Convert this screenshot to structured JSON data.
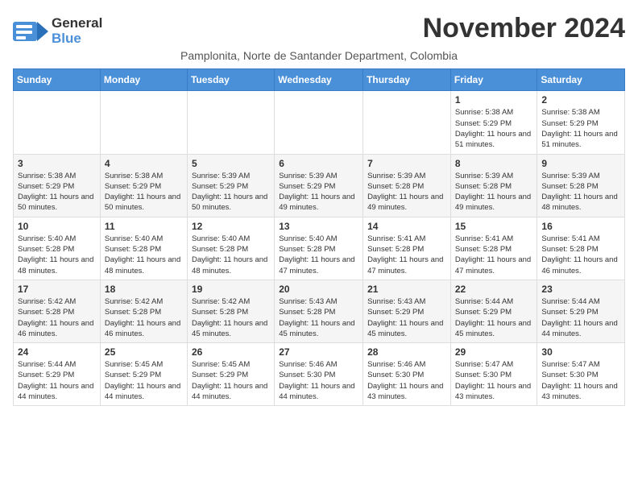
{
  "header": {
    "logo_general": "General",
    "logo_blue": "Blue",
    "month_title": "November 2024",
    "location": "Pamplonita, Norte de Santander Department, Colombia"
  },
  "weekdays": [
    "Sunday",
    "Monday",
    "Tuesday",
    "Wednesday",
    "Thursday",
    "Friday",
    "Saturday"
  ],
  "weeks": [
    [
      {
        "day": "",
        "info": ""
      },
      {
        "day": "",
        "info": ""
      },
      {
        "day": "",
        "info": ""
      },
      {
        "day": "",
        "info": ""
      },
      {
        "day": "",
        "info": ""
      },
      {
        "day": "1",
        "info": "Sunrise: 5:38 AM\nSunset: 5:29 PM\nDaylight: 11 hours\nand 51 minutes."
      },
      {
        "day": "2",
        "info": "Sunrise: 5:38 AM\nSunset: 5:29 PM\nDaylight: 11 hours\nand 51 minutes."
      }
    ],
    [
      {
        "day": "3",
        "info": "Sunrise: 5:38 AM\nSunset: 5:29 PM\nDaylight: 11 hours\nand 50 minutes."
      },
      {
        "day": "4",
        "info": "Sunrise: 5:38 AM\nSunset: 5:29 PM\nDaylight: 11 hours\nand 50 minutes."
      },
      {
        "day": "5",
        "info": "Sunrise: 5:39 AM\nSunset: 5:29 PM\nDaylight: 11 hours\nand 50 minutes."
      },
      {
        "day": "6",
        "info": "Sunrise: 5:39 AM\nSunset: 5:29 PM\nDaylight: 11 hours\nand 49 minutes."
      },
      {
        "day": "7",
        "info": "Sunrise: 5:39 AM\nSunset: 5:28 PM\nDaylight: 11 hours\nand 49 minutes."
      },
      {
        "day": "8",
        "info": "Sunrise: 5:39 AM\nSunset: 5:28 PM\nDaylight: 11 hours\nand 49 minutes."
      },
      {
        "day": "9",
        "info": "Sunrise: 5:39 AM\nSunset: 5:28 PM\nDaylight: 11 hours\nand 48 minutes."
      }
    ],
    [
      {
        "day": "10",
        "info": "Sunrise: 5:40 AM\nSunset: 5:28 PM\nDaylight: 11 hours\nand 48 minutes."
      },
      {
        "day": "11",
        "info": "Sunrise: 5:40 AM\nSunset: 5:28 PM\nDaylight: 11 hours\nand 48 minutes."
      },
      {
        "day": "12",
        "info": "Sunrise: 5:40 AM\nSunset: 5:28 PM\nDaylight: 11 hours\nand 48 minutes."
      },
      {
        "day": "13",
        "info": "Sunrise: 5:40 AM\nSunset: 5:28 PM\nDaylight: 11 hours\nand 47 minutes."
      },
      {
        "day": "14",
        "info": "Sunrise: 5:41 AM\nSunset: 5:28 PM\nDaylight: 11 hours\nand 47 minutes."
      },
      {
        "day": "15",
        "info": "Sunrise: 5:41 AM\nSunset: 5:28 PM\nDaylight: 11 hours\nand 47 minutes."
      },
      {
        "day": "16",
        "info": "Sunrise: 5:41 AM\nSunset: 5:28 PM\nDaylight: 11 hours\nand 46 minutes."
      }
    ],
    [
      {
        "day": "17",
        "info": "Sunrise: 5:42 AM\nSunset: 5:28 PM\nDaylight: 11 hours\nand 46 minutes."
      },
      {
        "day": "18",
        "info": "Sunrise: 5:42 AM\nSunset: 5:28 PM\nDaylight: 11 hours\nand 46 minutes."
      },
      {
        "day": "19",
        "info": "Sunrise: 5:42 AM\nSunset: 5:28 PM\nDaylight: 11 hours\nand 45 minutes."
      },
      {
        "day": "20",
        "info": "Sunrise: 5:43 AM\nSunset: 5:28 PM\nDaylight: 11 hours\nand 45 minutes."
      },
      {
        "day": "21",
        "info": "Sunrise: 5:43 AM\nSunset: 5:29 PM\nDaylight: 11 hours\nand 45 minutes."
      },
      {
        "day": "22",
        "info": "Sunrise: 5:44 AM\nSunset: 5:29 PM\nDaylight: 11 hours\nand 45 minutes."
      },
      {
        "day": "23",
        "info": "Sunrise: 5:44 AM\nSunset: 5:29 PM\nDaylight: 11 hours\nand 44 minutes."
      }
    ],
    [
      {
        "day": "24",
        "info": "Sunrise: 5:44 AM\nSunset: 5:29 PM\nDaylight: 11 hours\nand 44 minutes."
      },
      {
        "day": "25",
        "info": "Sunrise: 5:45 AM\nSunset: 5:29 PM\nDaylight: 11 hours\nand 44 minutes."
      },
      {
        "day": "26",
        "info": "Sunrise: 5:45 AM\nSunset: 5:29 PM\nDaylight: 11 hours\nand 44 minutes."
      },
      {
        "day": "27",
        "info": "Sunrise: 5:46 AM\nSunset: 5:30 PM\nDaylight: 11 hours\nand 44 minutes."
      },
      {
        "day": "28",
        "info": "Sunrise: 5:46 AM\nSunset: 5:30 PM\nDaylight: 11 hours\nand 43 minutes."
      },
      {
        "day": "29",
        "info": "Sunrise: 5:47 AM\nSunset: 5:30 PM\nDaylight: 11 hours\nand 43 minutes."
      },
      {
        "day": "30",
        "info": "Sunrise: 5:47 AM\nSunset: 5:30 PM\nDaylight: 11 hours\nand 43 minutes."
      }
    ]
  ]
}
